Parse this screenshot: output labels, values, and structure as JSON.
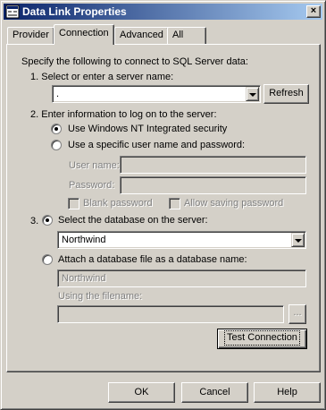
{
  "window": {
    "title": "Data Link Properties",
    "close_label": "×"
  },
  "tabs": [
    {
      "label": "Provider"
    },
    {
      "label": "Connection"
    },
    {
      "label": "Advanced"
    },
    {
      "label": "All"
    }
  ],
  "connection": {
    "intro": "Specify the following to connect to SQL Server data:",
    "step1": {
      "label": "1. Select or enter a server name:",
      "server_value": ".",
      "refresh_label": "Refresh"
    },
    "step2": {
      "label": "2. Enter information to log on to the server:",
      "option_nt": "Use Windows NT Integrated security",
      "option_specific": "Use a specific user name and password:",
      "username_label": "User name:",
      "username_value": "",
      "password_label": "Password:",
      "password_value": "",
      "blank_password_label": "Blank password",
      "allow_saving_label": "Allow saving password"
    },
    "step3": {
      "number": "3.",
      "option_select_db": "Select the database on the server:",
      "database_value": "Northwind",
      "option_attach": "Attach a database file as a database name:",
      "attach_name_value": "Northwind",
      "filename_label": "Using the filename:",
      "filename_value": "",
      "browse_label": "..."
    },
    "test_connection_label": "Test Connection"
  },
  "footer": {
    "ok_label": "OK",
    "cancel_label": "Cancel",
    "help_label": "Help"
  }
}
